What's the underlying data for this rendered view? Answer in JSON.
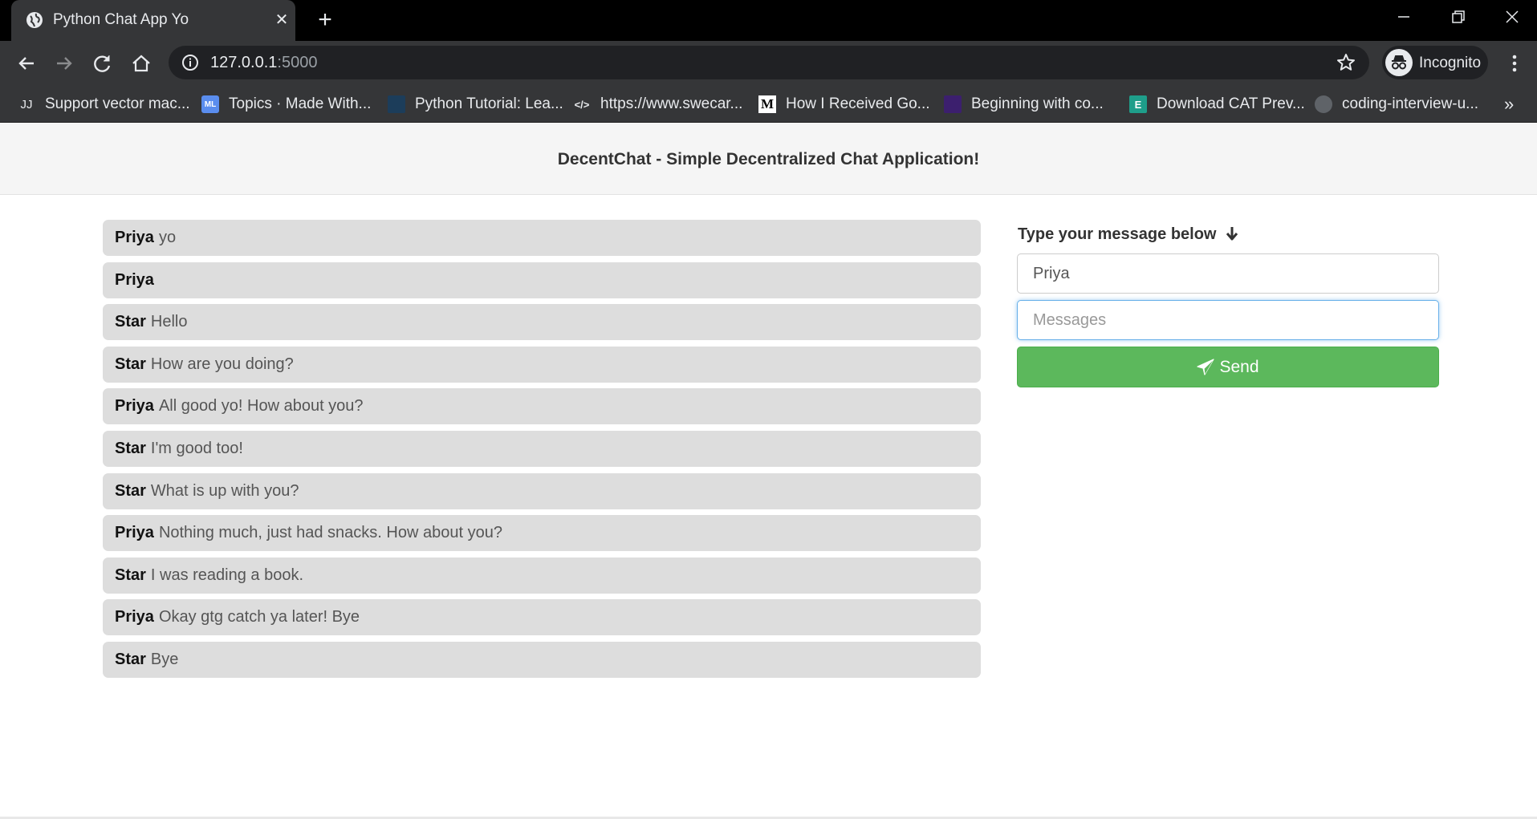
{
  "browser": {
    "tab_title": "Python Chat App Yo",
    "url_host": "127.0.0.1",
    "url_port": ":5000",
    "incognito_label": "Incognito",
    "bookmarks": [
      {
        "icon": "JJ",
        "label": "Support vector mac..."
      },
      {
        "icon": "ML",
        "label": "Topics · Made With..."
      },
      {
        "icon": "",
        "label": "Python Tutorial: Lea..."
      },
      {
        "icon": "</>",
        "label": "https://www.swecar..."
      },
      {
        "icon": "M",
        "label": "How I Received Go..."
      },
      {
        "icon": "",
        "label": "Beginning with co..."
      },
      {
        "icon": "E",
        "label": "Download CAT Prev..."
      },
      {
        "icon": "",
        "label": "coding-interview-u..."
      }
    ],
    "more_bookmarks": "»"
  },
  "page": {
    "header_title": "DecentChat - Simple Decentralized Chat Application!",
    "messages": [
      {
        "user": "Priya",
        "text": "yo"
      },
      {
        "user": "Priya",
        "text": ""
      },
      {
        "user": "Star",
        "text": "Hello"
      },
      {
        "user": "Star",
        "text": "How are you doing?"
      },
      {
        "user": "Priya",
        "text": "All good yo! How about you?"
      },
      {
        "user": "Star",
        "text": "I'm good too!"
      },
      {
        "user": "Star",
        "text": "What is up with you?"
      },
      {
        "user": "Priya",
        "text": "Nothing much, just had snacks. How about you?"
      },
      {
        "user": "Star",
        "text": "I was reading a book."
      },
      {
        "user": "Priya",
        "text": "Okay gtg catch ya later! Bye"
      },
      {
        "user": "Star",
        "text": "Bye"
      }
    ],
    "form": {
      "label": "Type your message below",
      "arrow": "🡇",
      "name_value": "Priya",
      "message_placeholder": "Messages",
      "send_label": "Send"
    }
  },
  "colors": {
    "send_button": "#5cb85c",
    "message_bg": "#dddddd",
    "header_bg": "#f5f5f5",
    "focus_border": "#66afe9"
  }
}
